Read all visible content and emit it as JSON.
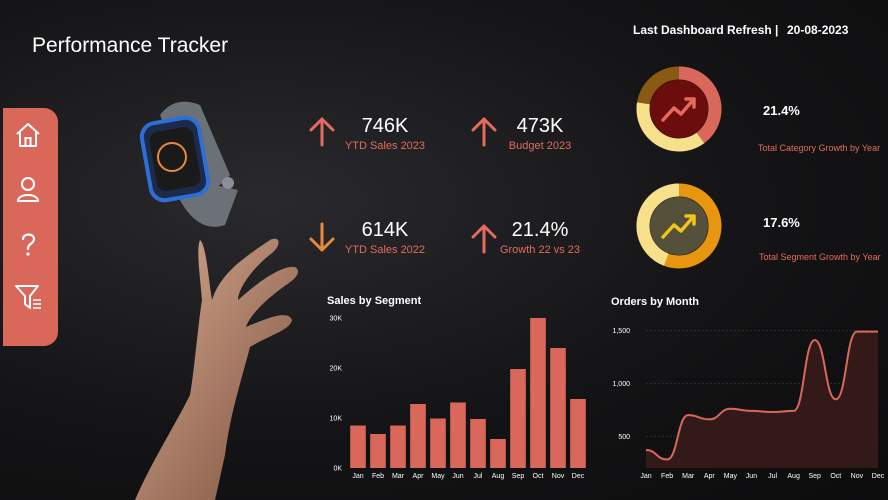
{
  "header": {
    "title": "Performance Tracker",
    "refresh_label": "Last Dashboard Refresh |",
    "refresh_date": "20-08-2023"
  },
  "sidebar": {
    "items": [
      {
        "icon": "home-icon"
      },
      {
        "icon": "user-icon"
      },
      {
        "icon": "help-icon"
      },
      {
        "icon": "filter-icon"
      }
    ]
  },
  "kpis": [
    {
      "value": "746K",
      "label": "YTD Sales 2023",
      "trend": "up",
      "color": "#e46b5d"
    },
    {
      "value": "473K",
      "label": "Budget 2023",
      "trend": "up",
      "color": "#e46b5d"
    },
    {
      "value": "614K",
      "label": "YTD Sales 2022",
      "trend": "down",
      "color": "#e88a3a"
    },
    {
      "value": "21.4%",
      "label": "Growth 22 vs 23",
      "trend": "up",
      "color": "#e46b5d"
    }
  ],
  "growth": [
    {
      "value": "21.4%",
      "label": "Total Category Growth by Year"
    },
    {
      "value": "17.6%",
      "label": "Total Segment Growth by Year"
    }
  ],
  "colors": {
    "accent": "#d9685a",
    "bar": "#d9685a",
    "gold": "#f0c419",
    "bg": "#141416"
  },
  "chart_data": [
    {
      "type": "bar",
      "title": "Sales by Segment",
      "categories": [
        "Jan",
        "Feb",
        "Mar",
        "Apr",
        "May",
        "Jun",
        "Jul",
        "Aug",
        "Sep",
        "Oct",
        "Nov",
        "Dec"
      ],
      "values": [
        8500,
        6800,
        8500,
        12800,
        9900,
        13100,
        9800,
        5800,
        19800,
        30000,
        24000,
        13800
      ],
      "ylim": [
        0,
        30000
      ],
      "yticks": [
        "0K",
        "10K",
        "20K",
        "30K"
      ]
    },
    {
      "type": "area",
      "title": "Orders by Month",
      "categories": [
        "Jan",
        "Feb",
        "Mar",
        "Apr",
        "May",
        "Jun",
        "Jul",
        "Aug",
        "Sep",
        "Oct",
        "Nov",
        "Dec"
      ],
      "values": [
        370,
        280,
        700,
        660,
        760,
        740,
        730,
        740,
        1410,
        850,
        1490,
        1490
      ],
      "ylim": [
        200,
        1600
      ],
      "yticks": [
        "500",
        "1,000",
        "1,500"
      ]
    }
  ]
}
